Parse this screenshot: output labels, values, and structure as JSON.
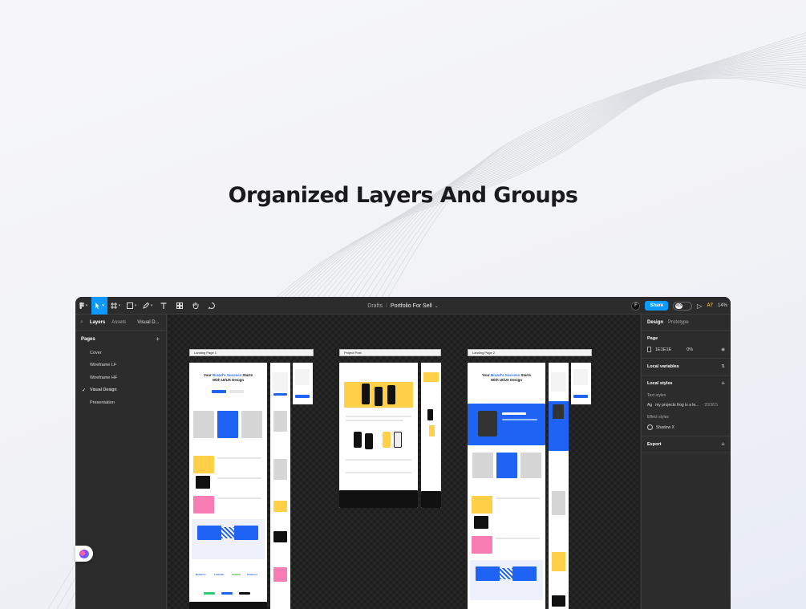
{
  "headline": "Organized Layers And Groups",
  "colors": {
    "accent": "#0d99ff",
    "brand_blue": "#1f63f5",
    "yellow": "#ffd048",
    "canvas_bg": "#1e1e1e",
    "panel_bg": "#2c2c2c"
  },
  "toolbar": {
    "main_menu_icon": "figma-menu-icon",
    "tools": [
      "move-tool-icon",
      "frame-tool-icon",
      "shape-tool-icon",
      "pen-tool-icon",
      "text-tool-icon",
      "resources-icon",
      "hand-tool-icon",
      "comment-icon"
    ],
    "breadcrumb_drafts": "Drafts",
    "breadcrumb_sep": "/",
    "file_name": "Portfolio For Sell",
    "file_caret": "⌄",
    "avatar_label": "F",
    "share_label": "Share",
    "dev_mode_label": "</>",
    "present_icon": "▷",
    "aa_label": "A7",
    "zoom_label": "14%"
  },
  "left_panel": {
    "tab_layers": "Layers",
    "tab_assets": "Assets",
    "page_selector": "Visual D...",
    "pages_title": "Pages",
    "add_page": "+",
    "pages": [
      {
        "label": "Cover",
        "active": false
      },
      {
        "label": "Wireframe LF",
        "active": false
      },
      {
        "label": "Wireframe HF",
        "active": false
      },
      {
        "label": "Visual Design",
        "active": true
      },
      {
        "label": "Presentation",
        "active": false
      }
    ]
  },
  "canvas": {
    "frames": [
      {
        "label": "Landing Page 1"
      },
      {
        "label": "Project Post"
      },
      {
        "label": "Landing Page 2"
      }
    ],
    "lp1_hero_line1": "Your",
    "lp1_hero_brand": "Brand's Success",
    "lp1_hero_line1_end": "Starts",
    "lp1_hero_line2": "With UI/UX Design",
    "lp2_hero_line1": "Your",
    "lp2_hero_brand": "Brand's Success",
    "lp2_hero_line1_end": "Starts",
    "lp2_hero_line2": "With UI/UX Design",
    "logos": [
      "Behance",
      "LinkedIn",
      "Upwork",
      "Pinterest"
    ]
  },
  "right_panel": {
    "tab_design": "Design",
    "tab_prototype": "Prototype",
    "page_title": "Page",
    "page_color": "1E1E1E",
    "page_opacity": "0%",
    "local_variables": "Local variables",
    "local_styles": "Local styles",
    "text_styles": "Text styles",
    "text_style_prefix": "Ag",
    "text_style_name": "my projects frog is a le...",
    "text_style_value": "· 20/38.5",
    "effect_styles": "Effect styles",
    "effect_name": "Shadow X",
    "export": "Export",
    "plus": "+"
  }
}
